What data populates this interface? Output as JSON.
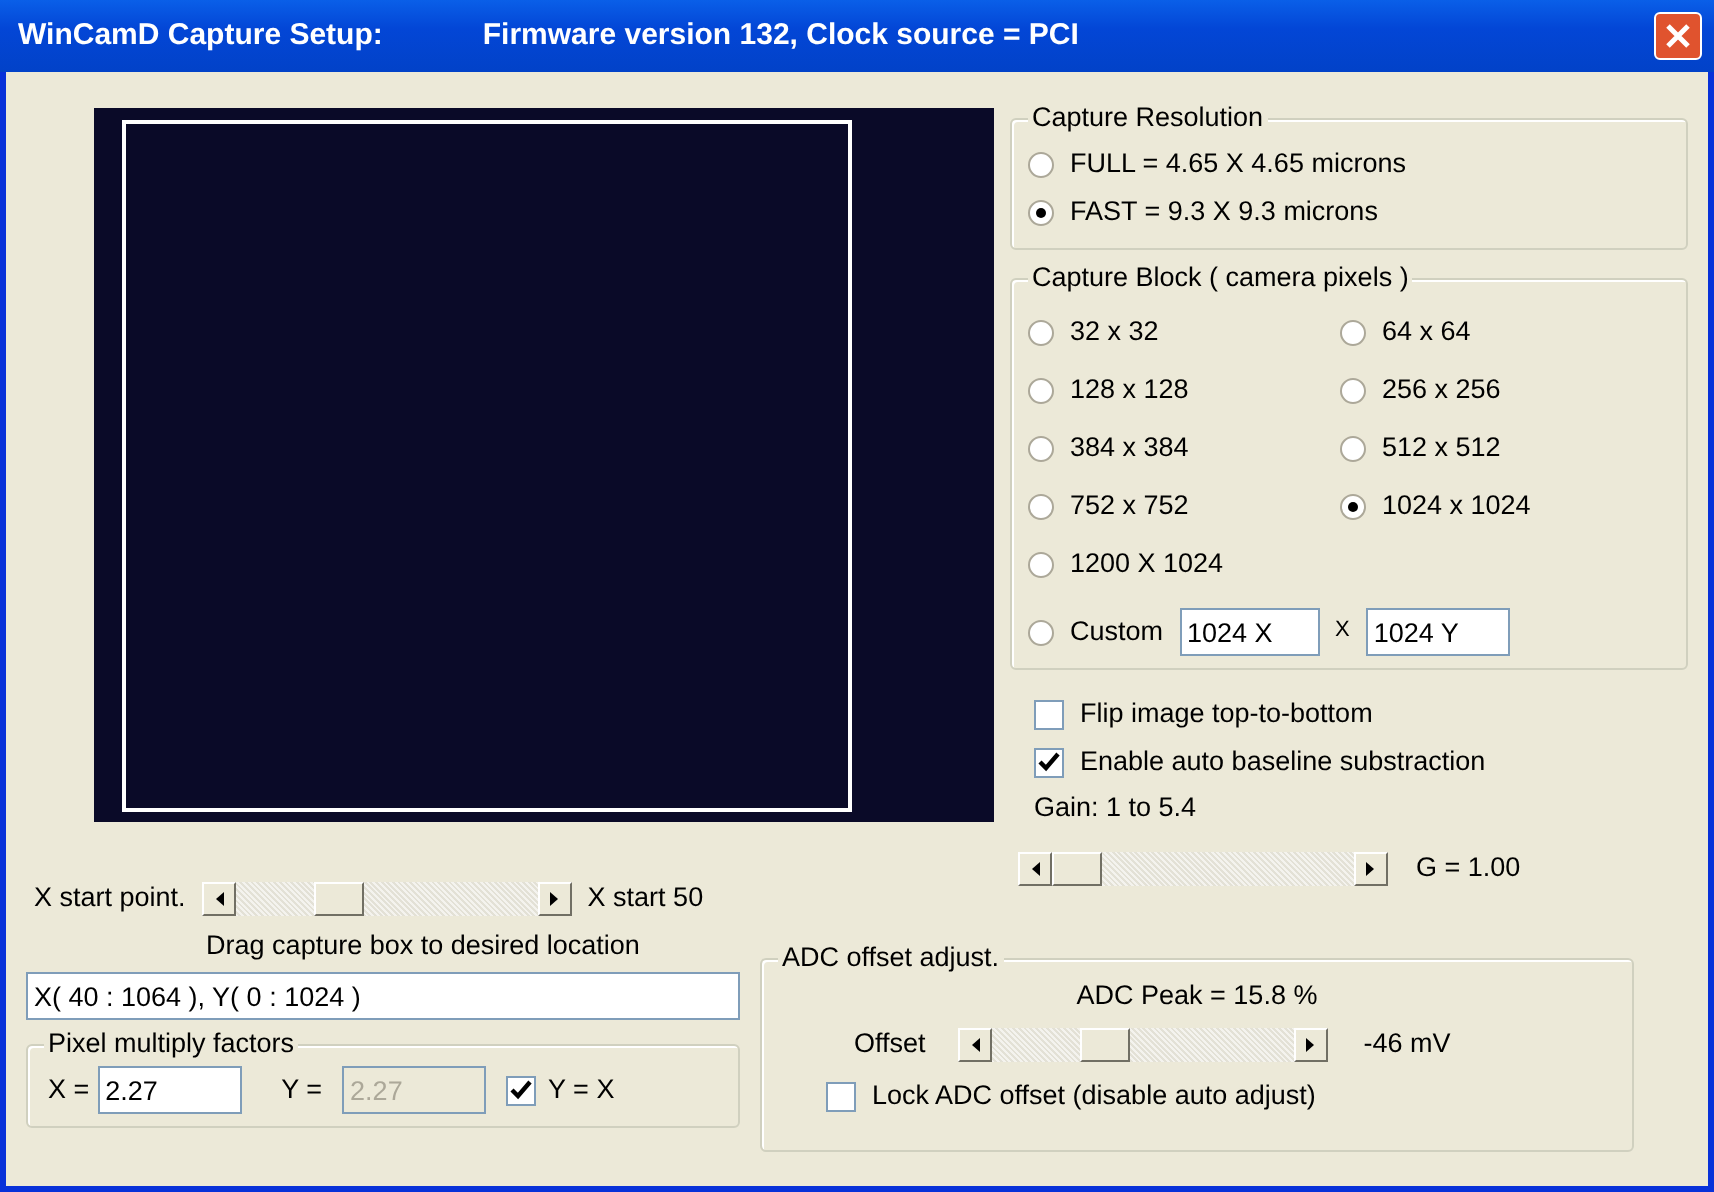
{
  "window": {
    "title": "WinCamD Capture Setup:",
    "subtitle": "Firmware version 132,  Clock source = PCI"
  },
  "x_start": {
    "label": "X start point.",
    "level": 0.31,
    "reading": "X start 50"
  },
  "drag_hint": "Drag capture box to desired location",
  "capture_range": {
    "value": "X( 40 : 1064 ), Y( 0 : 1024 )"
  },
  "pixel_factors": {
    "title": "Pixel multiply factors",
    "x_label": "X =",
    "x_value": "2.27",
    "y_label": "Y =",
    "y_value": "2.27",
    "y_disabled": true,
    "link_label": "Y = X",
    "link_checked": true
  },
  "capture_resolution": {
    "title": "Capture Resolution",
    "options": [
      {
        "label": "FULL = 4.65 X 4.65 microns",
        "selected": false
      },
      {
        "label": "FAST = 9.3 X 9.3 microns",
        "selected": true
      }
    ]
  },
  "capture_block": {
    "title": "Capture Block ( camera pixels )",
    "options": [
      {
        "label": "32 x 32",
        "selected": false
      },
      {
        "label": "64 x 64",
        "selected": false
      },
      {
        "label": "128 x 128",
        "selected": false
      },
      {
        "label": "256 x 256",
        "selected": false
      },
      {
        "label": "384 x 384",
        "selected": false
      },
      {
        "label": "512 x 512",
        "selected": false
      },
      {
        "label": "752 x 752",
        "selected": false
      },
      {
        "label": "1024 x 1024",
        "selected": true
      },
      {
        "label": "1200 X 1024",
        "selected": false
      }
    ],
    "custom": {
      "label": "Custom",
      "selected": false,
      "x_value": "1024 X",
      "separator": "X",
      "y_value": "1024 Y"
    }
  },
  "options": [
    {
      "label": "Flip image top-to-bottom",
      "checked": false
    },
    {
      "label": "Enable auto baseline substraction",
      "checked": true
    }
  ],
  "gain": {
    "label": "Gain:  1 to 5.4",
    "level": 0.0,
    "reading": "G = 1.00"
  },
  "adc": {
    "title": "ADC offset adjust.",
    "peak": "ADC Peak = 15.8 %",
    "offset_label": "Offset",
    "level": 0.35,
    "reading": "-46 mV",
    "lock_label": "Lock ADC offset  (disable auto adjust)",
    "lock_checked": false
  }
}
